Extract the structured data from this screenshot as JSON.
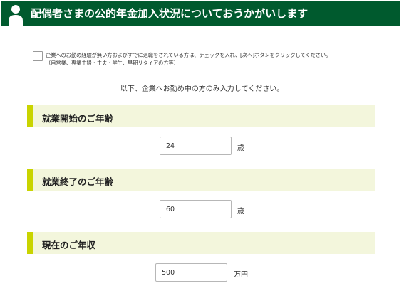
{
  "header": {
    "title": "配偶者さまの公的年金加入状況についておうかがいします",
    "icon": "person-icon",
    "background": "#005a2e"
  },
  "notice": {
    "line1": "企業へのお勤め経験が無い方およびすでに退職をされている方は、チェックを入れ、[次へ]ボタンをクリックしてください。",
    "line2": "（自営業、専業主婦・主夫・学生、早期リタイアの方等）",
    "checked": false
  },
  "instruction": "以下、企業へお勤め中の方のみ入力してください。",
  "sections": [
    {
      "label": "就業開始のご年齢",
      "value": "24",
      "unit": "歳"
    },
    {
      "label": "就業終了のご年齢",
      "value": "60",
      "unit": "歳"
    },
    {
      "label": "現在のご年収",
      "value": "500",
      "unit": "万円"
    }
  ],
  "colors": {
    "accent": "#c9d400",
    "section_bg": "#f3f6dc"
  }
}
